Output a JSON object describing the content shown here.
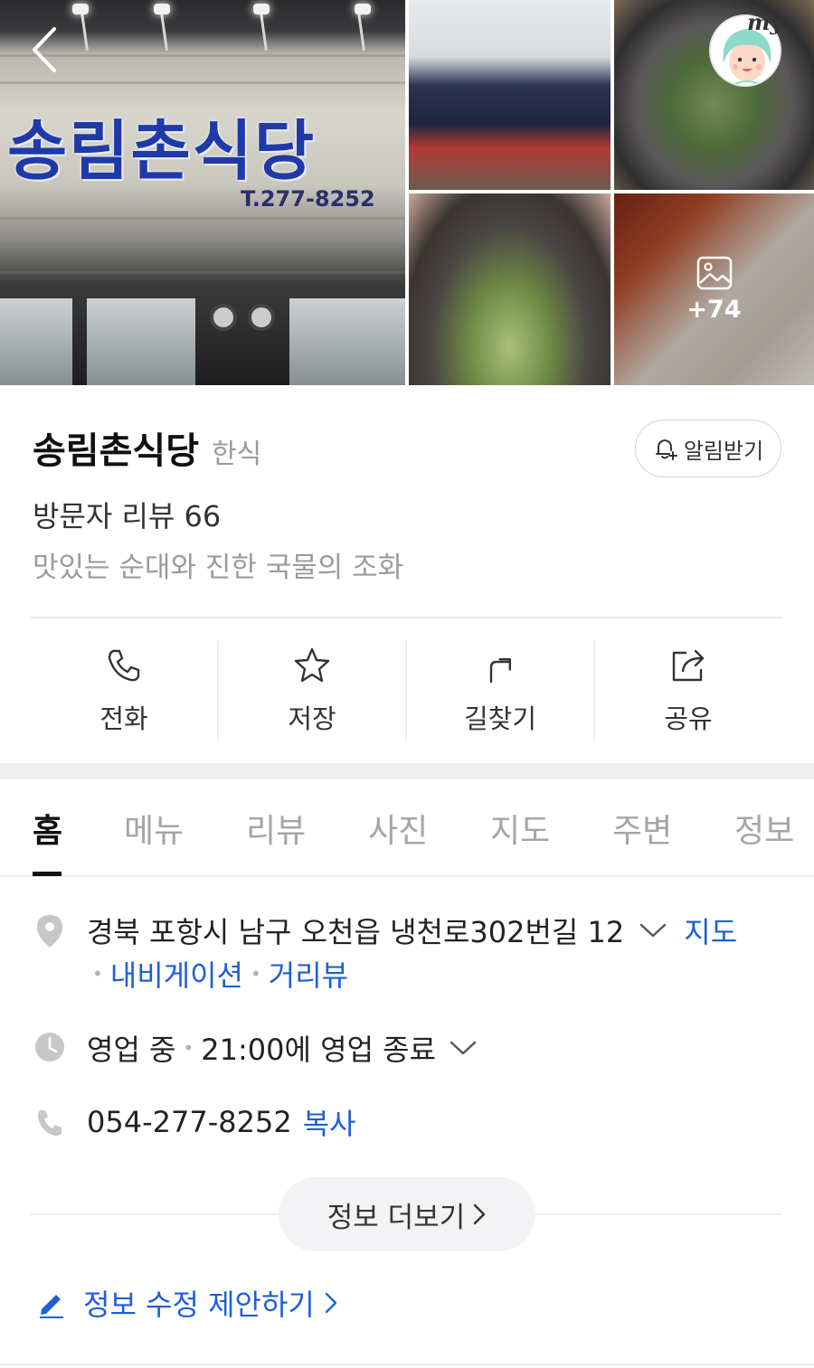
{
  "gallery": {
    "sign_text": "송림촌식당",
    "sign_phone": "T.277-8252",
    "avatar_badge": "my",
    "more_photos_count": "+74"
  },
  "place": {
    "name": "송림촌식당",
    "category": "한식",
    "alert_label": "알림받기",
    "review_count": "방문자 리뷰 66",
    "tagline": "맛있는 순대와 진한 국물의 조화"
  },
  "actions": [
    {
      "label": "전화",
      "icon": "phone-icon"
    },
    {
      "label": "저장",
      "icon": "star-icon"
    },
    {
      "label": "길찾기",
      "icon": "directions-icon"
    },
    {
      "label": "공유",
      "icon": "share-icon"
    }
  ],
  "tabs": [
    "홈",
    "메뉴",
    "리뷰",
    "사진",
    "지도",
    "주변",
    "정보"
  ],
  "active_tab": "홈",
  "info": {
    "address": "경북 포항시 남구 오천읍 냉천로302번길 12",
    "map_link": "지도",
    "navigation_link": "내비게이션",
    "street_view_link": "거리뷰",
    "status": "영업 중",
    "closing": "21:00에 영업 종료",
    "phone": "054-277-8252",
    "copy_link": "복사",
    "more_info": "정보 더보기",
    "suggest_edit": "정보 수정 제안하기"
  },
  "colors": {
    "accent_blue": "#1f5fd6",
    "text_primary": "#222222",
    "text_muted": "#9b9b9b",
    "divider": "#ececec"
  }
}
